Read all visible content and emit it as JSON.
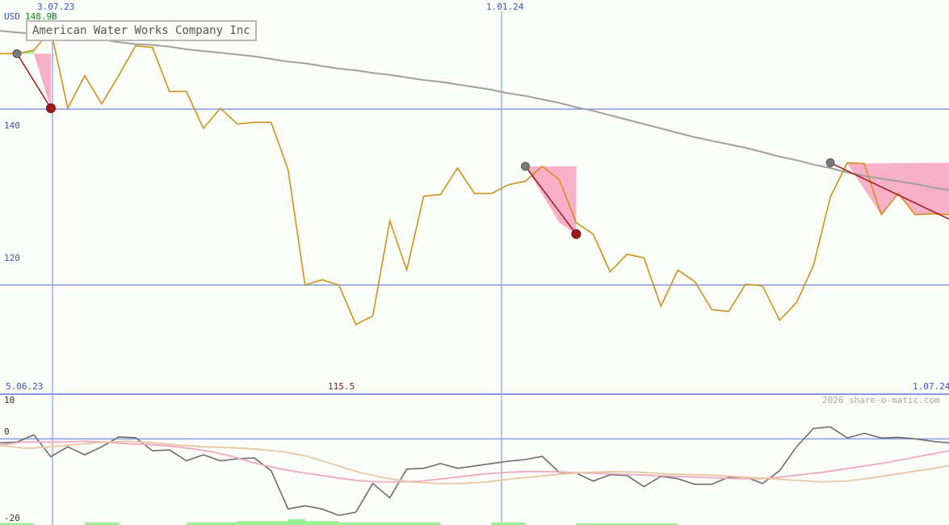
{
  "header": {
    "currency": "USD",
    "last_price": "148.98",
    "company": "American Water Works Company Inc"
  },
  "labels": {
    "date_top_1": "3.07.23",
    "date_top_2": "1.01.24",
    "date_start": "5.06.23",
    "min_value": "115.5",
    "date_end": "1.07.24",
    "watermark": "2026 share-o-matic.com",
    "y_140": "140",
    "y_120": "120",
    "osc_10": "10",
    "osc_0": "0",
    "osc_m20": "-20"
  },
  "colors": {
    "price": "#d0901a",
    "ma": "#a0a0a0",
    "grid": "#8898e8",
    "trend": "#a01818",
    "loss_fill": "#f8b0c8",
    "gain_fill": "#98e890",
    "osc": "#6c6c6c",
    "osc_pink": "#f0a8c0",
    "osc_tan": "#e8c8a0",
    "volume": "#98f090"
  },
  "chart_data": {
    "type": "line",
    "x_range": [
      "5.06.23",
      "1.07.24"
    ],
    "price_panel": {
      "ylim": [
        107.6,
        152.4
      ],
      "gridlines": [
        120,
        140
      ],
      "series": [
        {
          "values": [
            146.3,
            146.3,
            146.7,
            149.0,
            140.1,
            143.8,
            140.6,
            143.8,
            147.2,
            147.0,
            142.0,
            142.0,
            137.8,
            140.1,
            138.3,
            138.5,
            138.5,
            133.1,
            120.0,
            120.6,
            120.0,
            115.5,
            116.5,
            127.3,
            121.7,
            130.1,
            130.3,
            133.3,
            130.4,
            130.4,
            131.4,
            131.8,
            133.5,
            132.0,
            127.1,
            125.8,
            121.5,
            123.5,
            123.1,
            117.6,
            121.7,
            120.4,
            117.2,
            117.0,
            120.1,
            119.9,
            116.0,
            118.0,
            122.2,
            130.0,
            133.9,
            133.8,
            128.0,
            130.4,
            128.0,
            128.1,
            128.0
          ],
          "color": "#d0901a"
        },
        {
          "values": [
            148.9,
            148.7,
            148.6,
            148.4,
            148.3,
            148.1,
            147.9,
            147.6,
            147.4,
            147.3,
            147.1,
            146.8,
            146.6,
            146.4,
            146.2,
            146.0,
            145.7,
            145.4,
            145.2,
            144.9,
            144.6,
            144.4,
            144.1,
            143.9,
            143.6,
            143.3,
            143.1,
            142.8,
            142.5,
            142.2,
            141.8,
            141.5,
            141.1,
            140.7,
            140.2,
            139.8,
            139.3,
            138.8,
            138.3,
            137.8,
            137.3,
            136.8,
            136.4,
            136.0,
            135.6,
            135.1,
            134.6,
            134.2,
            133.7,
            133.3,
            132.8,
            132.4,
            132.1,
            131.8,
            131.5,
            131.1,
            130.8
          ],
          "color": "#a0a0a0"
        }
      ],
      "trend_segments": [
        {
          "from": [
            1,
            146.3
          ],
          "to": [
            3,
            140.1
          ]
        },
        {
          "from": [
            31,
            133.5
          ],
          "to": [
            34,
            125.8
          ]
        },
        {
          "from": [
            49,
            133.9
          ],
          "to": [
            56,
            127.5
          ]
        }
      ]
    },
    "oscillator_panel": {
      "ylim": [
        -20,
        10
      ],
      "gridlines": [
        0
      ],
      "series": [
        {
          "values": [
            -1.0,
            -0.8,
            1.0,
            -4.5,
            -2.0,
            -4.0,
            -2.0,
            0.5,
            0.3,
            -3.0,
            -2.8,
            -5.5,
            -4.0,
            -5.5,
            -5.0,
            -4.8,
            -8.0,
            -17.6,
            -16.8,
            -17.6,
            -19.2,
            -18.4,
            -11.2,
            -14.8,
            -7.6,
            -7.4,
            -6.2,
            -7.4,
            -6.8,
            -6.2,
            -5.6,
            -5.2,
            -4.4,
            -8.4,
            -8.6,
            -10.6,
            -9.0,
            -9.2,
            -12.0,
            -9.4,
            -10.0,
            -11.4,
            -11.4,
            -9.6,
            -9.6,
            -11.2,
            -8.0,
            -2.0,
            2.6,
            3.0,
            0.2,
            1.4,
            0.2,
            0.4,
            0.0,
            -0.6,
            -1.0
          ],
          "color": "#6c6c6c"
        },
        {
          "values": [
            -1.6,
            -0.8,
            -0.8,
            -0.8,
            -0.6,
            -0.8,
            -1.2,
            -1.4,
            -1.8,
            -2.4,
            -3.2,
            -4.4,
            -6.0,
            -7.2,
            -8.2,
            -9.0,
            -9.8,
            -10.5,
            -10.8,
            -10.8,
            -10.6,
            -10.0,
            -9.4,
            -8.8,
            -8.4,
            -8.2,
            -8.2,
            -8.4,
            -8.6,
            -8.8,
            -9.0,
            -9.2,
            -9.4,
            -9.6,
            -9.8,
            -10.0,
            -10.0,
            -9.6,
            -9.0,
            -8.4,
            -7.6,
            -6.8,
            -6.0,
            -5.0,
            -4.0,
            -3.0
          ],
          "x_start": 0,
          "x_end": 56,
          "color": "#f0a8c0"
        },
        {
          "values": [
            -1.6,
            -2.4,
            -2.0,
            -1.4,
            -0.8,
            -0.6,
            -1.0,
            -1.6,
            -2.0,
            -2.2,
            -2.6,
            -3.2,
            -4.4,
            -6.4,
            -8.4,
            -9.8,
            -10.8,
            -11.2,
            -11.2,
            -10.8,
            -10.0,
            -9.4,
            -8.8,
            -8.4,
            -8.2,
            -8.4,
            -8.8,
            -9.0,
            -9.2,
            -9.6,
            -10.0,
            -10.4,
            -10.8,
            -10.6,
            -9.8,
            -8.8,
            -7.8,
            -6.8
          ],
          "x_start": 0,
          "x_end": 56,
          "color": "#e8c8a0"
        }
      ],
      "volume_blocks": [
        {
          "x": [
            0,
            2
          ],
          "level": 1.2
        },
        {
          "x": [
            5,
            7
          ],
          "level": 1.6
        },
        {
          "x": [
            11,
            14
          ],
          "level": 1.6
        },
        {
          "x": [
            14,
            17
          ],
          "level": 2.4
        },
        {
          "x": [
            17,
            18
          ],
          "level": 3.6
        },
        {
          "x": [
            18,
            20
          ],
          "level": 2.4
        },
        {
          "x": [
            20,
            26
          ],
          "level": 1.6
        },
        {
          "x": [
            29,
            31
          ],
          "level": 1.6
        },
        {
          "x": [
            34,
            40
          ],
          "level": 1.0
        }
      ]
    }
  }
}
